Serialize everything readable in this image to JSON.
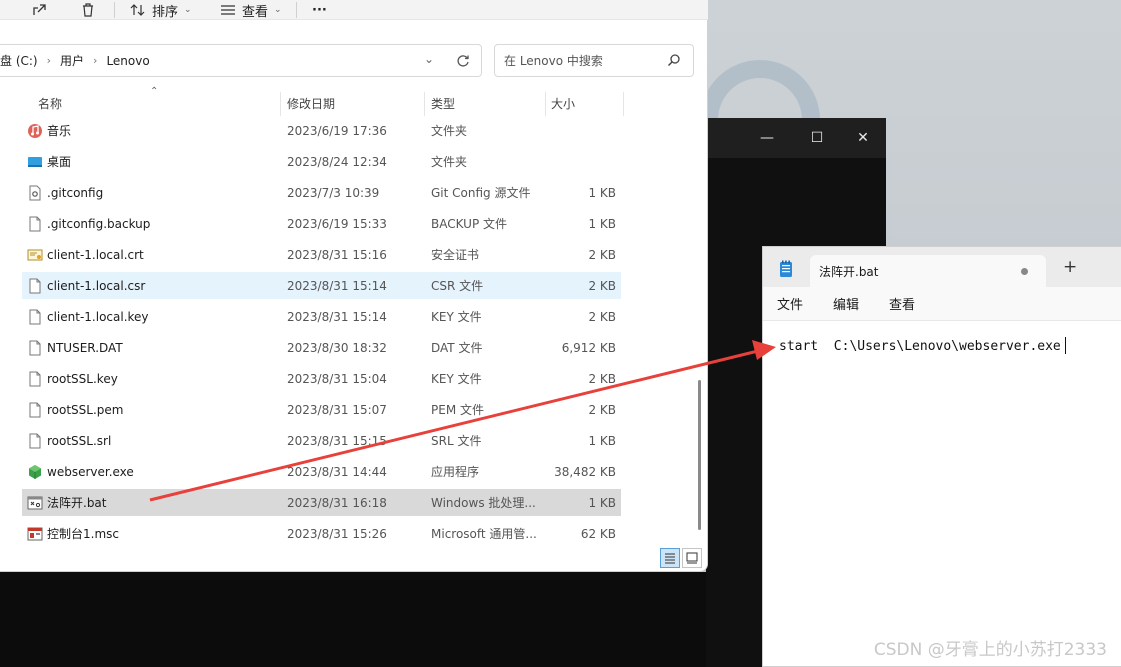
{
  "toolbar": {
    "sort_label": "排序",
    "view_label": "查看",
    "more_label": "···"
  },
  "address": {
    "crumbs": [
      "磁盘 (C:)",
      "用户",
      "Lenovo"
    ]
  },
  "search": {
    "placeholder": "在 Lenovo 中搜索"
  },
  "columns": {
    "name": "名称",
    "date": "修改日期",
    "type": "类型",
    "size": "大小"
  },
  "files": [
    {
      "name": "音乐",
      "date": "2023/6/19 17:36",
      "type": "文件夹",
      "size": "",
      "icon": "music-folder-icon"
    },
    {
      "name": "桌面",
      "date": "2023/8/24 12:34",
      "type": "文件夹",
      "size": "",
      "icon": "desktop-folder-icon"
    },
    {
      "name": ".gitconfig",
      "date": "2023/7/3 10:39",
      "type": "Git Config 源文件",
      "size": "1 KB",
      "icon": "config-file-icon"
    },
    {
      "name": ".gitconfig.backup",
      "date": "2023/6/19 15:33",
      "type": "BACKUP 文件",
      "size": "1 KB",
      "icon": "file-icon"
    },
    {
      "name": "client-1.local.crt",
      "date": "2023/8/31 15:16",
      "type": "安全证书",
      "size": "2 KB",
      "icon": "certificate-icon"
    },
    {
      "name": "client-1.local.csr",
      "date": "2023/8/31 15:14",
      "type": "CSR 文件",
      "size": "2 KB",
      "icon": "file-icon"
    },
    {
      "name": "client-1.local.key",
      "date": "2023/8/31 15:14",
      "type": "KEY 文件",
      "size": "2 KB",
      "icon": "file-icon"
    },
    {
      "name": "NTUSER.DAT",
      "date": "2023/8/30 18:32",
      "type": "DAT 文件",
      "size": "6,912 KB",
      "icon": "file-icon"
    },
    {
      "name": "rootSSL.key",
      "date": "2023/8/31 15:04",
      "type": "KEY 文件",
      "size": "2 KB",
      "icon": "file-icon"
    },
    {
      "name": "rootSSL.pem",
      "date": "2023/8/31 15:07",
      "type": "PEM 文件",
      "size": "2 KB",
      "icon": "file-icon"
    },
    {
      "name": "rootSSL.srl",
      "date": "2023/8/31 15:15",
      "type": "SRL 文件",
      "size": "1 KB",
      "icon": "file-icon"
    },
    {
      "name": "webserver.exe",
      "date": "2023/8/31 14:44",
      "type": "应用程序",
      "size": "38,482 KB",
      "icon": "exe-cube-icon"
    },
    {
      "name": "法阵开.bat",
      "date": "2023/8/31 16:18",
      "type": "Windows 批处理...",
      "size": "1 KB",
      "icon": "batch-file-icon"
    },
    {
      "name": "控制台1.msc",
      "date": "2023/8/31 15:26",
      "type": "Microsoft 通用管...",
      "size": "62 KB",
      "icon": "msc-console-icon"
    }
  ],
  "notepad": {
    "tab_title": "法阵开.bat",
    "menu_file": "文件",
    "menu_edit": "编辑",
    "menu_view": "查看",
    "content": "start  C:\\Users\\Lenovo\\webserver.exe"
  },
  "darkwin": {
    "minimize": "—",
    "maximize": "☐",
    "close": "✕"
  },
  "watermark": "CSDN @牙膏上的小苏打2333",
  "colors": {
    "accent": "#0078d4",
    "arrow": "#e8403a",
    "selected_row": "#d9d9d9",
    "hover_row": "#e5f3fd"
  }
}
